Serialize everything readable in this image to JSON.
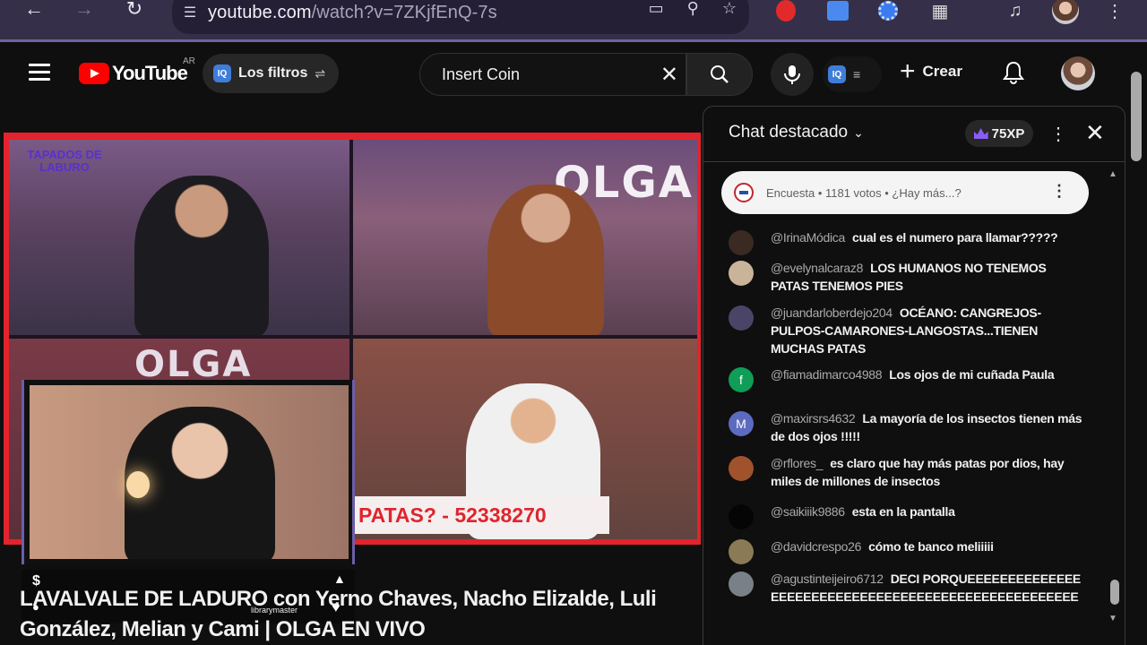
{
  "browser": {
    "url_host": "youtube.com",
    "url_path": "/watch?v=7ZKjfEnQ-7s"
  },
  "header": {
    "logo_text": "YouTube",
    "country_code": "AR",
    "filters_label": "Los filtros",
    "search_query": "Insert Coin",
    "create_label": "Crear"
  },
  "video": {
    "overlay_text_1": "OLGA",
    "overlay_text_2": "OLGA",
    "phone_banner": "PATAS? - 52338270",
    "show_logo": "TAPADOS DE LABURO",
    "webcam_user": "librarymaster"
  },
  "title": "LAVALVALE DE LADURO con Yerno Chaves, Nacho Elizalde, Luli González, Melian y Cami | OLGA EN VIVO",
  "chat": {
    "title": "Chat destacado",
    "xp": "75XP",
    "poll_text": "Encuesta • 1181 votos • ¿Hay más...?",
    "messages": [
      {
        "author": "@IrinaMódica",
        "text": "cual es el numero para llamar?????",
        "avatar_color": "#3a2a22",
        "initial": ""
      },
      {
        "author": "@evelynalcaraz8",
        "text": "LOS HUMANOS NO TENEMOS PATAS TENEMOS PIES",
        "avatar_color": "#c9b49a",
        "initial": ""
      },
      {
        "author": "@juandarloberdejo204",
        "text": "OCÉANO: CANGREJOS-PULPOS-CAMARONES-LANGOSTAS...TIENEN MUCHAS PATAS",
        "avatar_color": "#4a4566",
        "initial": ""
      },
      {
        "author": "@fiamadimarco4988",
        "text": "Los ojos de mi cuñada Paula",
        "avatar_color": "#0f9d58",
        "initial": "f"
      },
      {
        "author": "@maxirsrs4632",
        "text": "La mayoría de los insectos tienen más de dos ojos !!!!!",
        "avatar_color": "#5c6bc0",
        "initial": "M"
      },
      {
        "author": "@rflores_",
        "text": "es claro que hay más patas por dios, hay miles de millones de insectos",
        "avatar_color": "#a0522d",
        "initial": ""
      },
      {
        "author": "@saikiiik9886",
        "text": "esta en la pantalla",
        "avatar_color": "#050505",
        "initial": ""
      },
      {
        "author": "@davidcrespo26",
        "text": "cómo te banco meliiiii",
        "avatar_color": "#8a7a55",
        "initial": ""
      },
      {
        "author": "@agustinteijeiro6712",
        "text": "DECI PORQUEEEEEEEEEEEEEEEEEEEEEEEEEEEEEEEEEEEEEEEEEEEEEEEEEEEE",
        "avatar_color": "#7a8088",
        "initial": ""
      }
    ]
  }
}
